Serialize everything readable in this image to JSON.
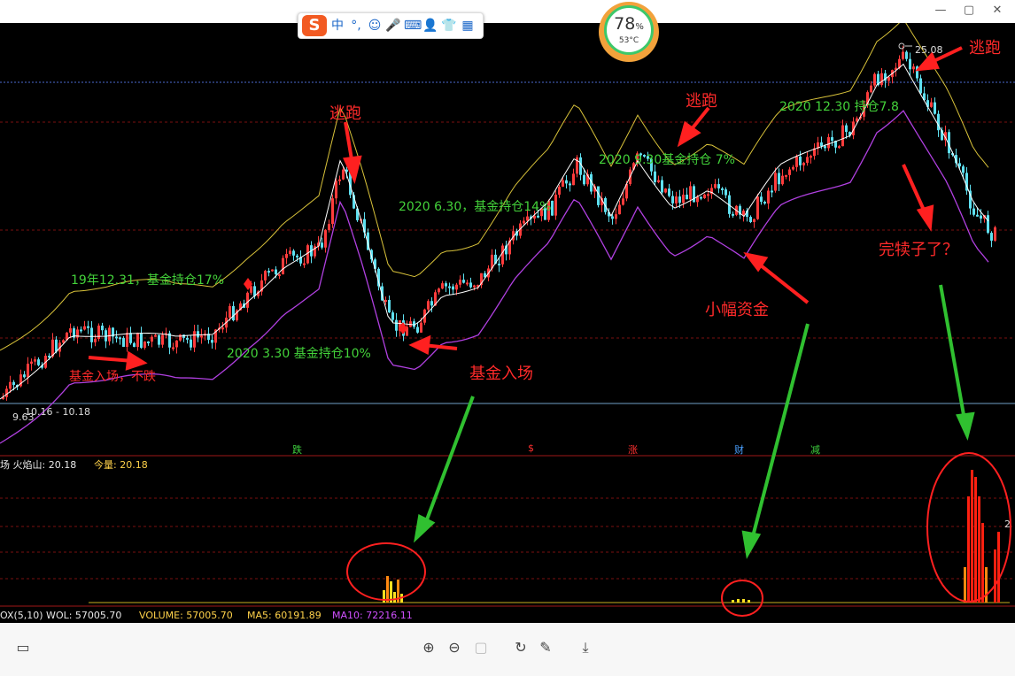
{
  "window": {
    "controls": [
      "—",
      "▢",
      "✕"
    ]
  },
  "ime_toolbar": {
    "logo": "S",
    "items": [
      "中",
      "°,",
      "☺",
      "🎤",
      "⌨",
      "👤",
      "👕",
      "▦"
    ]
  },
  "perf_widget": {
    "percent": "78",
    "percent_sign": "%",
    "temperature": "53°C"
  },
  "annotations": {
    "taopao1": "逃跑",
    "taopao2": "逃跑",
    "taopao3": "逃跑",
    "jijin_ruchang": "基金入场",
    "xiaofu_zijin": "小幅资金",
    "wandu": "完犊子了？",
    "jijin_buDie": "基金入场，不跌",
    "h_1912": "19年12.31，基金持仓17%",
    "h_2003": "2020 3.30 基金持仓10%",
    "h_2006": "2020 6.30，基金持仓14%",
    "h_2009": "2020 9.30基金持仓 7%",
    "h_2012": "2020 12.30 持仓7.8"
  },
  "price_labels": {
    "high": "25.08",
    "low": "9.63",
    "range": "10.16 - 10.18"
  },
  "event_markers": {
    "die": "跌",
    "dollar": "$",
    "zhang": "涨",
    "cai": "财",
    "jian": "减"
  },
  "indicator_panel": {
    "name": "场 火焰山: 20.18",
    "today": "今量: 20.18",
    "right_tick": "2"
  },
  "volume_panel": {
    "line": "OX(5,10) WOL: 57005.70",
    "volume": "VOLUME: 57005.70",
    "ma5": "MA5: 60191.89",
    "ma10": "MA10: 72216.11"
  },
  "colors": {
    "up": "#ff3c3c",
    "down": "#5fe0f0",
    "ma": "#ffffff",
    "upper": "#d8c23a",
    "lower": "#b040e0",
    "annotation_green": "#43d23a",
    "annotation_red": "#ff2a2a"
  },
  "bottom_toolbar": {
    "icons": [
      "layout-icon",
      "zoom-in-icon",
      "zoom-out-icon",
      "fit-icon",
      "rotate-icon",
      "edit-icon",
      "download-icon"
    ]
  }
}
